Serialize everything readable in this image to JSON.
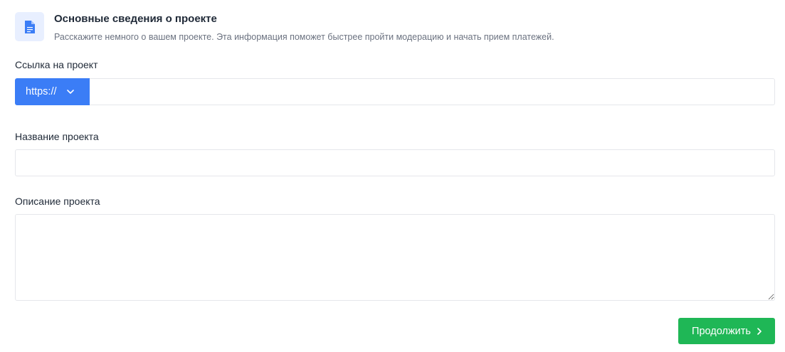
{
  "header": {
    "icon": "document-icon",
    "title": "Основные сведения о проекте",
    "subtitle": "Расскажите немного о вашем проекте. Эта информация поможет быстрее пройти модерацию и начать прием платежей."
  },
  "url_field": {
    "label": "Ссылка на проект",
    "protocol": "https://",
    "value": "",
    "placeholder": ""
  },
  "name_field": {
    "label": "Название проекта",
    "value": "",
    "placeholder": ""
  },
  "description_field": {
    "label": "Описание проекта",
    "value": "",
    "placeholder": ""
  },
  "submit": {
    "label": "Продолжить",
    "icon": "chevron-right-icon"
  },
  "colors": {
    "primary": "#3b7df6",
    "success": "#1fb756",
    "icon_bg": "#e8efff"
  }
}
